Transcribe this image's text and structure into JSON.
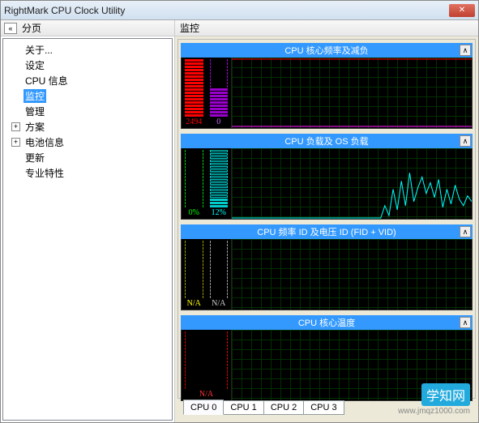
{
  "window": {
    "title": "RightMark CPU Clock Utility"
  },
  "left": {
    "header": "分页",
    "items": [
      {
        "label": "关于...",
        "expandable": false,
        "selected": false
      },
      {
        "label": "设定",
        "expandable": false,
        "selected": false
      },
      {
        "label": "CPU 信息",
        "expandable": false,
        "selected": false
      },
      {
        "label": "监控",
        "expandable": false,
        "selected": true
      },
      {
        "label": "管理",
        "expandable": false,
        "selected": false
      },
      {
        "label": "方案",
        "expandable": true,
        "selected": false
      },
      {
        "label": "电池信息",
        "expandable": true,
        "selected": false
      },
      {
        "label": "更新",
        "expandable": false,
        "selected": false
      },
      {
        "label": "专业特性",
        "expandable": false,
        "selected": false
      }
    ]
  },
  "right": {
    "header": "监控",
    "panels": [
      {
        "title": "CPU 核心频率及减负",
        "bars": [
          {
            "color": "#ff0000",
            "label": "2494",
            "labelColor": "#ff0000",
            "fill": 1.0
          },
          {
            "color": "#9900cc",
            "label": "0",
            "labelColor": "#cc66ff",
            "fill": 0.5
          }
        ],
        "lines": [
          {
            "color": "#ff0000",
            "path": "flat-top"
          },
          {
            "color": "#ff00ff",
            "path": "flat-bottom"
          }
        ]
      },
      {
        "title": "CPU 负载及 OS 负载",
        "bars": [
          {
            "color": "#00cc00",
            "label": "0%",
            "labelColor": "#00ff00",
            "fill": 0.0
          },
          {
            "color": "#00cccc",
            "label": "12%",
            "labelColor": "#00ffff",
            "fill": 0.12
          }
        ],
        "lines": [
          {
            "color": "#00ffff",
            "path": "spiky"
          }
        ]
      },
      {
        "title": "CPU 频率 ID 及电压 ID (FID + VID)",
        "bars": [
          {
            "color": "#999900",
            "label": "N/A",
            "labelColor": "#ffff00",
            "fill": 0.0
          },
          {
            "color": "#999999",
            "label": "N/A",
            "labelColor": "#cccccc",
            "fill": 0.0
          }
        ],
        "lines": []
      },
      {
        "title": "CPU 核心温度",
        "bars": [
          {
            "color": "#cc0000",
            "label": "N/A",
            "labelColor": "#ff3333",
            "fill": 0.0
          }
        ],
        "lines": []
      }
    ],
    "tabs": [
      "CPU 0",
      "CPU 1",
      "CPU 2",
      "CPU 3"
    ],
    "activeTab": 0
  },
  "watermark": {
    "text": "学知网",
    "url": "www.jmqz1000.com"
  }
}
